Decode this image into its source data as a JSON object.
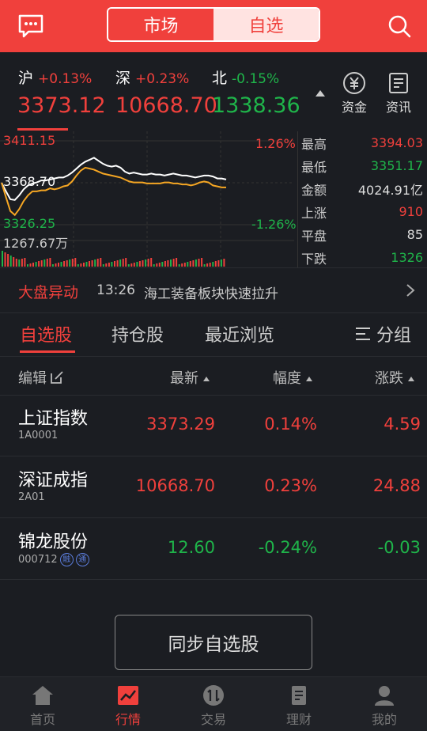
{
  "header": {
    "tab_market": "市场",
    "tab_watchlist": "自选"
  },
  "indices": [
    {
      "name": "沪",
      "change": "+0.13%",
      "value": "3373.12",
      "color": "#f0403c"
    },
    {
      "name": "深",
      "change": "+0.23%",
      "value": "10668.70",
      "color": "#f0403c"
    },
    {
      "name": "北",
      "change": "-0.15%",
      "value": "1338.36",
      "color": "#1fb44a"
    }
  ],
  "quick_links": {
    "funds": "资金",
    "news": "资讯"
  },
  "chart": {
    "high_label": "3411.15",
    "mid_label": "3368.70",
    "low_label": "3326.25",
    "pct_up": "1.26%",
    "pct_down": "-1.26%",
    "volume_label": "1267.67万"
  },
  "chart_data": {
    "type": "line",
    "ylim": [
      3326.25,
      3411.15
    ],
    "series": [
      {
        "values": [
          3368.7,
          3360,
          3352,
          3351.2,
          3356,
          3362,
          3366,
          3368,
          3369,
          3371,
          3371,
          3372,
          3373,
          3374,
          3374,
          3376,
          3379,
          3383,
          3387,
          3390,
          3392,
          3394,
          3391,
          3388,
          3386,
          3385,
          3386,
          3384,
          3380,
          3378,
          3379,
          3378,
          3377,
          3377,
          3378,
          3377,
          3377,
          3376,
          3377,
          3378,
          3377,
          3376,
          3376,
          3375,
          3374,
          3375,
          3376,
          3376,
          3375,
          3373,
          3373,
          3372
        ]
      },
      {
        "values": [
          3368.7,
          3354,
          3340,
          3336,
          3342,
          3350,
          3356,
          3360,
          3360,
          3361,
          3361,
          3363,
          3362,
          3363,
          3365,
          3366,
          3370,
          3376,
          3381,
          3384,
          3383,
          3382,
          3380,
          3378,
          3377,
          3376,
          3375,
          3374,
          3372,
          3370,
          3369,
          3369,
          3369,
          3368,
          3368,
          3368,
          3368,
          3369,
          3369,
          3368,
          3368,
          3367,
          3367,
          3366,
          3367,
          3369,
          3370,
          3369,
          3366,
          3365,
          3364,
          3364
        ]
      }
    ]
  },
  "stats": [
    {
      "label": "最高",
      "value": "3394.03",
      "color": "#f0403c"
    },
    {
      "label": "最低",
      "value": "3351.17",
      "color": "#1fb44a"
    },
    {
      "label": "金额",
      "value": "4024.91亿",
      "color": "#dddddd"
    },
    {
      "label": "上涨",
      "value": "910",
      "color": "#f0403c"
    },
    {
      "label": "平盘",
      "value": "85",
      "color": "#dddddd"
    },
    {
      "label": "下跌",
      "value": "1326",
      "color": "#1fb44a"
    }
  ],
  "news": {
    "tag": "大盘异动",
    "time": "13:26",
    "text": "海工装备板块快速拉升"
  },
  "list_tabs": {
    "watch": "自选股",
    "hold": "持仓股",
    "recent": "最近浏览",
    "group": "分组"
  },
  "table_header": {
    "edit": "编辑",
    "latest": "最新",
    "range": "幅度",
    "change": "涨跌"
  },
  "rows": [
    {
      "name": "上证指数",
      "code": "1A0001",
      "latest": "3373.29",
      "pct": "0.14%",
      "chg": "4.59",
      "color": "#f0403c"
    },
    {
      "name": "深证成指",
      "code": "2A01",
      "latest": "10668.70",
      "pct": "0.23%",
      "chg": "24.88",
      "color": "#f0403c"
    },
    {
      "name": "锦龙股份",
      "code": "000712",
      "latest": "12.60",
      "pct": "-0.24%",
      "chg": "-0.03",
      "color": "#1fb44a",
      "badges": [
        "融",
        "通"
      ]
    }
  ],
  "sync_button": "同步自选股",
  "bottom_nav": {
    "home": "首页",
    "market": "行情",
    "trade": "交易",
    "finance": "理财",
    "me": "我的"
  }
}
